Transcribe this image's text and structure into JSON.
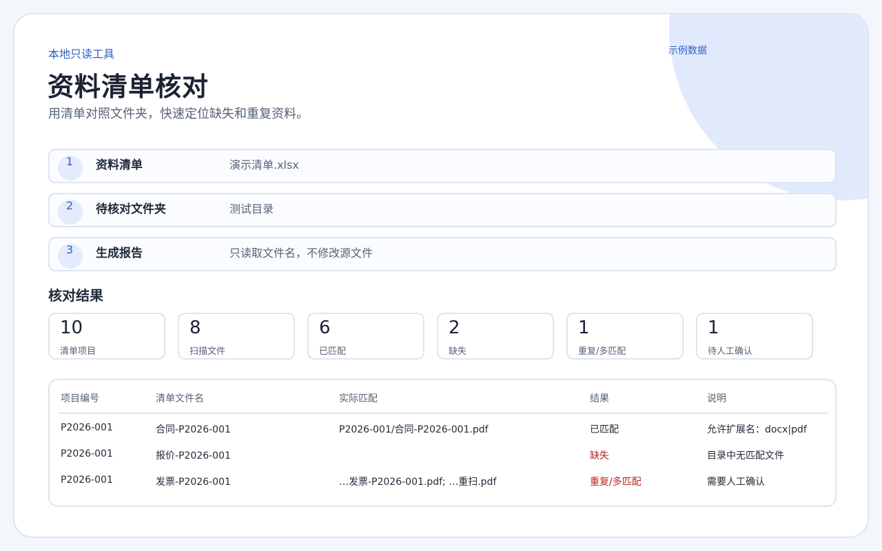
{
  "header": {
    "eyebrow": "本地只读工具",
    "title": "资料清单核对",
    "subtitle": "用清单对照文件夹，快速定位缺失和重复资料。",
    "demo_link": "示例数据"
  },
  "steps": [
    {
      "num": "1",
      "label": "资料清单",
      "value": "演示清单.xlsx"
    },
    {
      "num": "2",
      "label": "待核对文件夹",
      "value": "测试目录"
    },
    {
      "num": "3",
      "label": "生成报告",
      "value": "只读取文件名，不修改源文件"
    }
  ],
  "results": {
    "title": "核对结果",
    "stats": [
      {
        "value": "10",
        "label": "清单项目"
      },
      {
        "value": "8",
        "label": "扫描文件"
      },
      {
        "value": "6",
        "label": "已匹配"
      },
      {
        "value": "2",
        "label": "缺失"
      },
      {
        "value": "1",
        "label": "重复/多匹配"
      },
      {
        "value": "1",
        "label": "待人工确认"
      }
    ]
  },
  "table": {
    "columns": [
      "项目编号",
      "清单文件名",
      "实际匹配",
      "结果",
      "说明"
    ],
    "rows": [
      [
        "P2026-001",
        "合同-P2026-001",
        "P2026-001/合同-P2026-001.pdf",
        "已匹配",
        "允许扩展名：docx|pdf"
      ],
      [
        "P2026-001",
        "报价-P2026-001",
        "",
        "缺失",
        "目录中无匹配文件"
      ],
      [
        "P2026-001",
        "发票-P2026-001",
        "…发票-P2026-001.pdf; …重扫.pdf",
        "重复/多匹配",
        "需要人工确认"
      ]
    ]
  },
  "colors": {
    "accent": "#2d5fc4",
    "danger": "#b3261e",
    "border": "#dce5f1",
    "blob": "#e1eafd"
  }
}
